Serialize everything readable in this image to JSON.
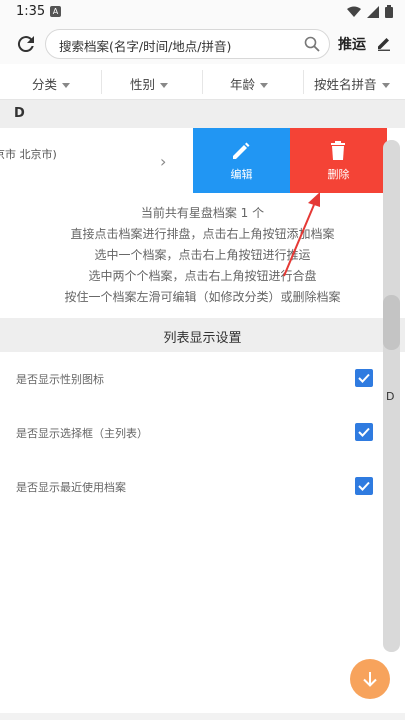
{
  "status_bar": {
    "time": "1:35",
    "app_badge": "A"
  },
  "toolbar": {
    "search_placeholder": "搜索档案(名字/时间/地点/拼音)",
    "action_label": "推运"
  },
  "filters": [
    {
      "label": "分类"
    },
    {
      "label": "性别"
    },
    {
      "label": "年龄"
    },
    {
      "label": "按姓名拼音"
    }
  ],
  "list": {
    "section_letter": "D",
    "row": {
      "place_text": "京市 北京市)",
      "edit_label": "编辑",
      "delete_label": "删除"
    }
  },
  "info_lines": [
    "当前共有星盘档案 1 个",
    "直接点击档案进行排盘，点击右上角按钮添加档案",
    "选中一个档案，点击右上角按钮进行推运",
    "选中两个个档案，点击右上角按钮进行合盘",
    "按住一个档案左滑可编辑（如修改分类）或删除档案"
  ],
  "settings": {
    "title": "列表显示设置",
    "items": [
      {
        "label": "是否显示性别图标",
        "checked": true
      },
      {
        "label": "是否显示选择框（主列表）",
        "checked": true
      },
      {
        "label": "是否显示最近使用档案",
        "checked": true
      }
    ]
  },
  "side_index": {
    "letter": "D"
  },
  "colors": {
    "edit": "#2196f3",
    "delete": "#f44336",
    "checkbox": "#2f7be0",
    "fab": "#f7a35c",
    "annotation_arrow": "#e53935"
  },
  "icons": {
    "refresh": "refresh-icon",
    "search": "search-icon",
    "edit": "pencil-icon",
    "delete": "trash-icon",
    "fab": "arrow-down-icon"
  }
}
